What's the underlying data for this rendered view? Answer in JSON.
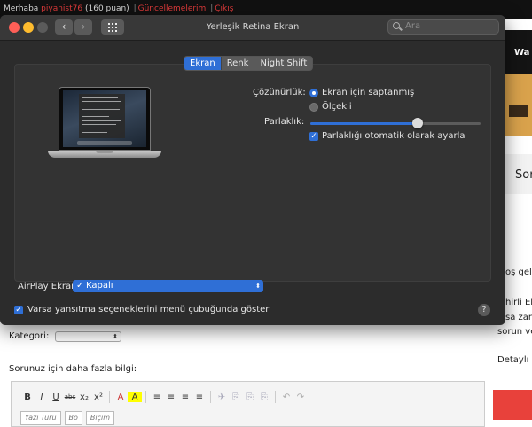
{
  "background_page": {
    "greeting_prefix": "Merhaba",
    "username": "piyanist76",
    "points": "(160 puan)",
    "updates_link": "Güncellemelerim",
    "logout_link": "Çıkış",
    "separator": "|",
    "right_dark_text": "Wa",
    "right_sor_text": "Sor",
    "snippets": [
      "oş gele",
      "hirli El",
      "sa zan",
      "sorun ve",
      "Detaylı b"
    ],
    "kategori_label": "Kategori:",
    "kategori_select_arrow": "⬍",
    "bilgi_label": "Sorunuz için daha fazla bilgi:",
    "editor_row1": [
      "B",
      "I",
      "U",
      "abc",
      "x₂",
      "x²",
      "A",
      "A",
      "≡",
      "≡",
      "≡",
      "≡",
      "✈",
      "⎘",
      "⎘",
      "⎘",
      "↶",
      "↷"
    ],
    "editor_selects": [
      "Yazı Türü",
      "Bo",
      "Biçim"
    ]
  },
  "window": {
    "title": "Yerleşik Retina Ekran",
    "search_placeholder": "Ara",
    "back": "‹",
    "forward": "›",
    "tabs": [
      {
        "label": "Ekran",
        "active": true
      },
      {
        "label": "Renk",
        "active": false
      },
      {
        "label": "Night Shift",
        "active": false
      }
    ],
    "resolution_label": "Çözünürlük:",
    "resolution_options": [
      {
        "label": "Ekran için saptanmış",
        "selected": true
      },
      {
        "label": "Ölçekli",
        "selected": false
      }
    ],
    "brightness_label": "Parlaklık:",
    "brightness_level": 0.63,
    "auto_brightness_label": "Parlaklığı otomatik olarak ayarla",
    "auto_brightness_checked": true,
    "airplay_label": "AirPlay Ekran",
    "airplay_value": "Kapalı",
    "airplay_checkmark": "✓",
    "airplay_arrows": "⬍",
    "mirroring_label": "Varsa yansıtma seçeneklerini menü çubuğunda göster",
    "mirroring_checked": true,
    "help": "?",
    "checkmark": "✓"
  },
  "colors": {
    "accent": "#2f6fd6",
    "window_bg": "#2c2c2c",
    "link_red": "#e23b3b"
  }
}
